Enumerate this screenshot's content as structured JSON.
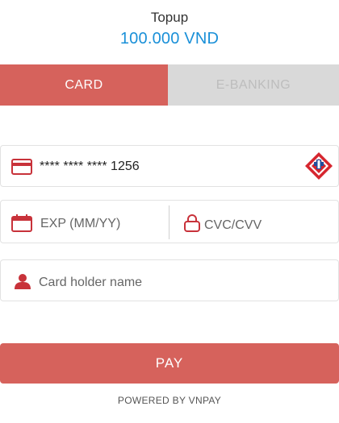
{
  "header": {
    "title": "Topup",
    "amount": "100.000 VND"
  },
  "tabs": [
    {
      "label": "CARD",
      "active": true
    },
    {
      "label": "E-BANKING",
      "active": false
    }
  ],
  "form": {
    "card_number_value": "**** **** **** 1256",
    "exp_placeholder": "EXP (MM/YY)",
    "cvc_placeholder": "CVC/CVV",
    "holder_placeholder": "Card holder name"
  },
  "pay_label": "PAY",
  "footer_text": "POWERED BY VNPAY",
  "colors": {
    "accent": "#d6625c",
    "amount": "#1a90d8",
    "icon": "#c8323a",
    "tab_inactive": "#d9d9d9"
  },
  "icons": [
    "credit-card-icon",
    "bank-logo-icon",
    "calendar-icon",
    "lock-icon",
    "user-icon"
  ]
}
